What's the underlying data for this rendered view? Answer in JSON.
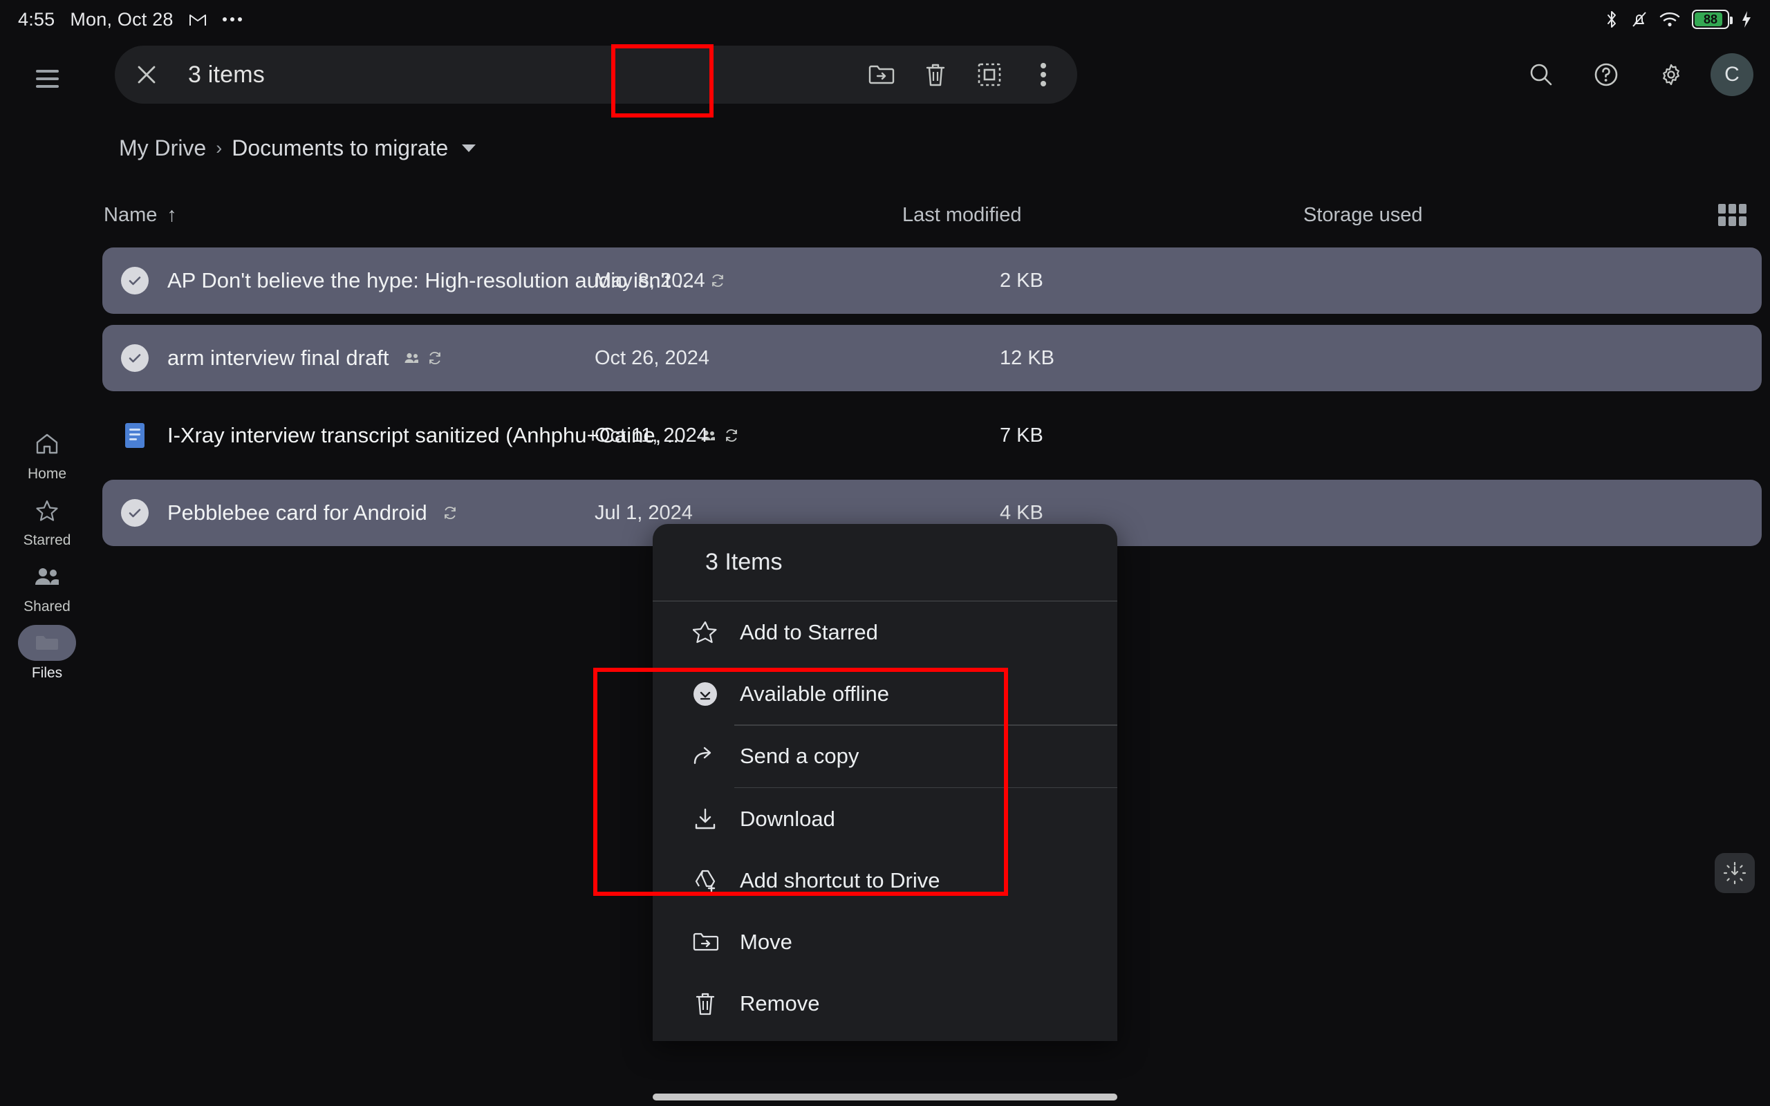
{
  "status_bar": {
    "time": "4:55",
    "date": "Mon, Oct 28",
    "gmail_icon": "gmail-icon",
    "overflow_icon": "more-dots-icon",
    "bluetooth_icon": "bluetooth-icon",
    "silent_icon": "notifications-off-icon",
    "wifi_icon": "wifi-icon",
    "battery_level": "88",
    "charging_icon": "charging-bolt-icon"
  },
  "rail": {
    "menu_icon": "hamburger-menu-icon",
    "items": [
      {
        "label": "Home",
        "icon": "home-icon",
        "active": false
      },
      {
        "label": "Starred",
        "icon": "star-icon",
        "active": false
      },
      {
        "label": "Shared",
        "icon": "people-icon",
        "active": false
      },
      {
        "label": "Files",
        "icon": "folder-icon",
        "active": true
      }
    ]
  },
  "selection_bar": {
    "close_label": "×",
    "title": "3 items",
    "tools": [
      {
        "name": "move-to-folder",
        "icon": "folder-move-icon"
      },
      {
        "name": "delete",
        "icon": "trash-icon"
      },
      {
        "name": "select-all",
        "icon": "select-all-icon"
      },
      {
        "name": "more-options",
        "icon": "three-dots-vertical-icon"
      }
    ]
  },
  "top_right": {
    "search_icon": "search-icon",
    "help_icon": "help-circle-icon",
    "settings_icon": "gear-icon",
    "avatar_initial": "C"
  },
  "breadcrumb": {
    "root": "My Drive",
    "separator": "›",
    "current": "Documents to migrate",
    "caret": "chevron-down-icon"
  },
  "columns": {
    "name": "Name",
    "sort_arrow": "↑",
    "last_modified": "Last modified",
    "storage_used": "Storage used",
    "view_toggle_icon": "grid-view-icon"
  },
  "files": [
    {
      "name": "AP Don't believe the hype: High-resolution audio isn't ...",
      "modified": "May 8, 2024",
      "size": "2 KB",
      "selected": true,
      "shared": false,
      "offline": true,
      "icon": "check-circle-icon"
    },
    {
      "name": "arm interview final draft",
      "modified": "Oct 26, 2024",
      "size": "12 KB",
      "selected": true,
      "shared": true,
      "offline": true,
      "icon": "check-circle-icon"
    },
    {
      "name": "I-Xray interview transcript sanitized (Anhphu+Caine, ...",
      "modified": "Oct 11, 2024",
      "size": "7 KB",
      "selected": false,
      "shared": true,
      "offline": true,
      "icon": "google-docs-icon"
    },
    {
      "name": "Pebblebee card for Android",
      "modified": "Jul 1, 2024",
      "size": "4 KB",
      "selected": true,
      "shared": false,
      "offline": true,
      "icon": "check-circle-icon"
    }
  ],
  "context_menu": {
    "header": "3 Items",
    "items": [
      {
        "label": "Add to Starred",
        "icon": "star-outline-icon",
        "divider_after": false
      },
      {
        "label": "Available offline",
        "icon": "available-offline-icon",
        "divider_after": true
      },
      {
        "label": "Send a copy",
        "icon": "share-arrow-icon",
        "divider_after": true
      },
      {
        "label": "Download",
        "icon": "download-icon",
        "divider_after": false
      },
      {
        "label": "Add shortcut to Drive",
        "icon": "add-shortcut-drive-icon",
        "divider_after": false
      },
      {
        "label": "Move",
        "icon": "folder-move-icon",
        "divider_after": false
      },
      {
        "label": "Remove",
        "icon": "trash-icon",
        "divider_after": false
      }
    ]
  },
  "floating_button": {
    "icon": "brightness-dim-icon"
  },
  "annotations": {
    "accent_color": "#ff0000",
    "box_1_target": "more-options-button",
    "box_2_target": "available-offline-send-a-copy-download-items"
  }
}
